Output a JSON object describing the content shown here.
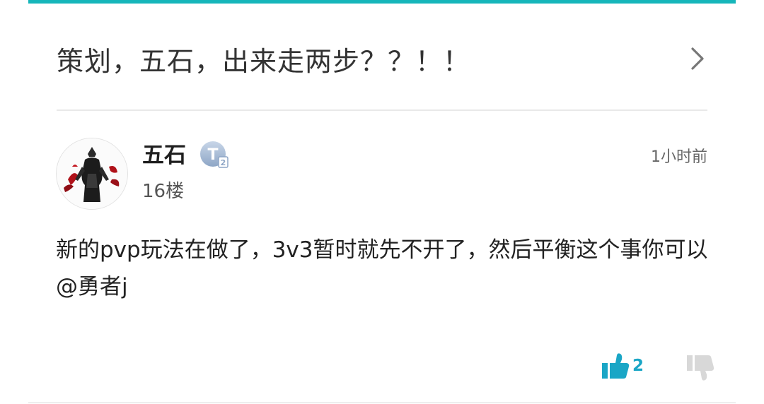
{
  "thread": {
    "title": "策划，五石，出来走两步？？！！"
  },
  "post": {
    "author": "五石",
    "badge_icon": "level-badge-icon",
    "floor": "16楼",
    "time": "1小时前",
    "content": "新的pvp玩法在做了，3v3暂时就先不开了，然后平衡这个事你可以@勇者j",
    "likes": "2"
  },
  "colors": {
    "accent": "#15b6ba",
    "like": "#1aa6c6",
    "dislike": "#d8d8d8"
  }
}
